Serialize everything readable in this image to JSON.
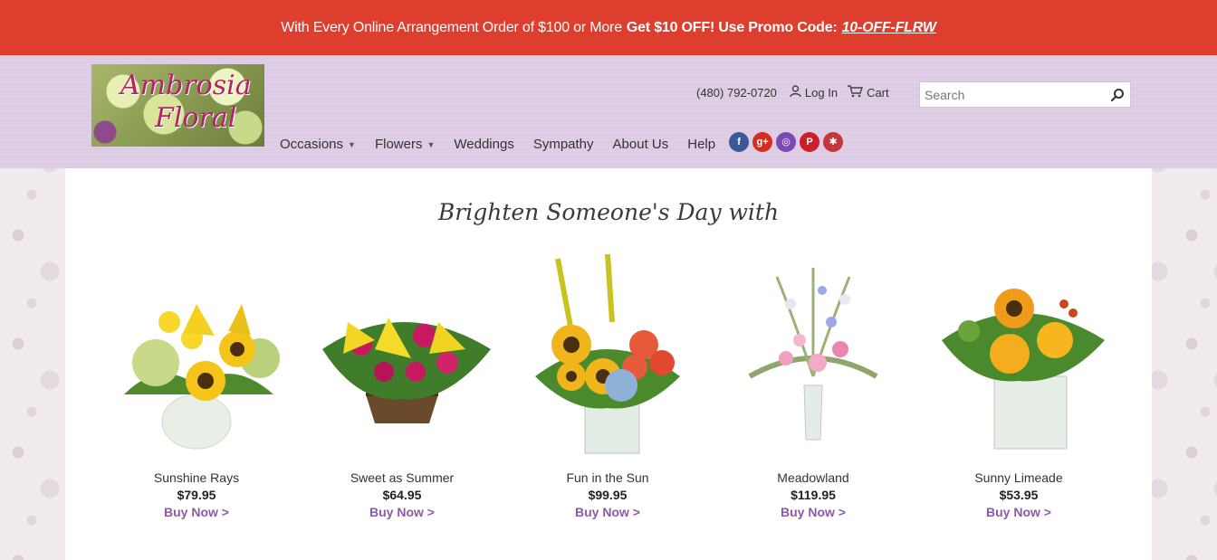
{
  "promo": {
    "lead": "With Every Online Arrangement Order of $100 or More",
    "offer": "Get $10 OFF! Use Promo Code:",
    "code": "10-OFF-FLRW"
  },
  "header": {
    "logo_text_1": "Ambrosia",
    "logo_text_2": "Floral",
    "phone": "(480) 792-0720",
    "login_label": "Log In",
    "cart_label": "Cart",
    "search_placeholder": "Search"
  },
  "nav": {
    "items": [
      {
        "label": "Occasions",
        "dropdown": true
      },
      {
        "label": "Flowers",
        "dropdown": true
      },
      {
        "label": "Weddings",
        "dropdown": false
      },
      {
        "label": "Sympathy",
        "dropdown": false
      },
      {
        "label": "About Us",
        "dropdown": false
      },
      {
        "label": "Help",
        "dropdown": false
      }
    ],
    "social": [
      {
        "name": "facebook-icon",
        "glyph": "f",
        "color": "#3b5998"
      },
      {
        "name": "google-plus-icon",
        "glyph": "g+",
        "color": "#d62d20"
      },
      {
        "name": "instagram-icon",
        "glyph": "◎",
        "color": "#7a4ab2"
      },
      {
        "name": "pinterest-icon",
        "glyph": "P",
        "color": "#cb2027"
      },
      {
        "name": "yelp-icon",
        "glyph": "✱",
        "color": "#c3363a"
      }
    ]
  },
  "main": {
    "headline": "Brighten Someone's Day with",
    "products": [
      {
        "name": "Sunshine Rays",
        "price": "$79.95",
        "buy": "Buy Now >"
      },
      {
        "name": "Sweet as Summer",
        "price": "$64.95",
        "buy": "Buy Now >"
      },
      {
        "name": "Fun in the Sun",
        "price": "$99.95",
        "buy": "Buy Now >"
      },
      {
        "name": "Meadowland",
        "price": "$119.95",
        "buy": "Buy Now >"
      },
      {
        "name": "Sunny Limeade",
        "price": "$53.95",
        "buy": "Buy Now >"
      }
    ]
  },
  "colors": {
    "promo_bg": "#de3e2d",
    "header_bg": "#dccbe3",
    "buy_link": "#8e5aa6"
  }
}
